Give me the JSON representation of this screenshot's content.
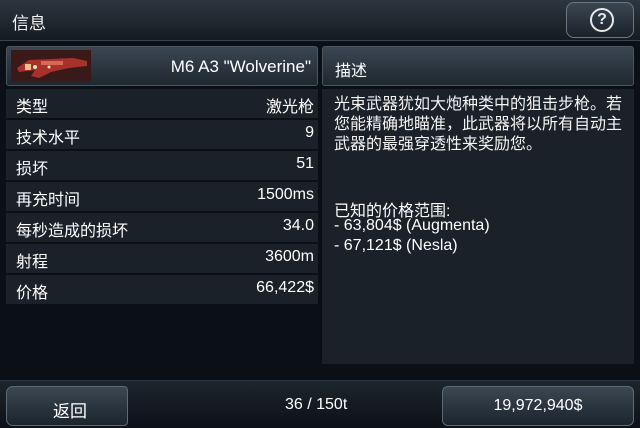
{
  "header": {
    "title": "信息",
    "help_label": "?"
  },
  "item": {
    "name": "M6 A3 \"Wolverine\"",
    "icon": "laser-rifle-icon"
  },
  "stats": [
    {
      "label": "类型",
      "value": "激光枪"
    },
    {
      "label": "技术水平",
      "value": "9"
    },
    {
      "label": "损坏",
      "value": "51"
    },
    {
      "label": "再充时间",
      "value": "1500ms"
    },
    {
      "label": "每秒造成的损坏",
      "value": "34.0"
    },
    {
      "label": "射程",
      "value": "3600m"
    },
    {
      "label": "价格",
      "value": "66,422$"
    }
  ],
  "description": {
    "title": "描述",
    "text": "光束武器犹如大炮种类中的狙击步枪。若您能精确地瞄准，此武器将以所有自动主武器的最强穿透性来奖励您。",
    "price_range_title": "已知的价格范围:",
    "price_lines": [
      "- 63,804$ (Augmenta)",
      "- 67,121$ (Nesla)"
    ]
  },
  "footer": {
    "back_label": "返回",
    "cargo_count": "36 / 150t",
    "money": "19,972,940$"
  },
  "colors": {
    "panel": "#1a2128",
    "background": "#0b1016",
    "weapon_red": "#a8312b"
  }
}
